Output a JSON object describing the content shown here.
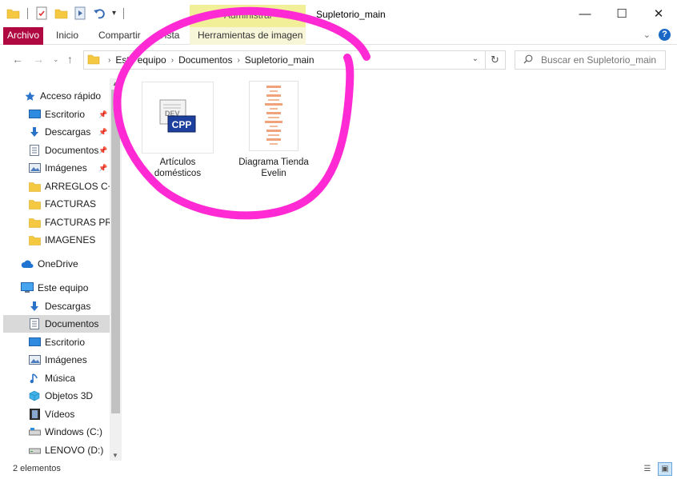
{
  "titlebar": {
    "title": "Supletorio_main",
    "context_group": "Administrar"
  },
  "ribbon": {
    "tabs": [
      "Archivo",
      "Inicio",
      "Compartir",
      "Vista",
      "Herramientas de imagen"
    ]
  },
  "address": {
    "crumbs": [
      "Este equipo",
      "Documentos",
      "Supletorio_main"
    ],
    "search_placeholder": "Buscar en Supletorio_main"
  },
  "sidebar": {
    "quick_access": "Acceso rápido",
    "quick_items": [
      {
        "label": "Escritorio",
        "icon": "desktop-icon",
        "pinned": true
      },
      {
        "label": "Descargas",
        "icon": "download-icon",
        "pinned": true
      },
      {
        "label": "Documentos",
        "icon": "document-icon",
        "pinned": true
      },
      {
        "label": "Imágenes",
        "icon": "pictures-icon",
        "pinned": true
      },
      {
        "label": "ARREGLOS C++",
        "icon": "folder-icon",
        "pinned": false
      },
      {
        "label": "FACTURAS",
        "icon": "folder-icon",
        "pinned": false
      },
      {
        "label": "FACTURAS PRODUCTOS",
        "icon": "folder-icon",
        "pinned": false
      },
      {
        "label": "IMAGENES",
        "icon": "folder-icon",
        "pinned": false
      }
    ],
    "onedrive": "OneDrive",
    "this_pc": "Este equipo",
    "pc_items": [
      {
        "label": "Descargas",
        "icon": "download-icon"
      },
      {
        "label": "Documentos",
        "icon": "document-icon"
      },
      {
        "label": "Escritorio",
        "icon": "desktop-icon"
      },
      {
        "label": "Imágenes",
        "icon": "pictures-icon"
      },
      {
        "label": "Música",
        "icon": "music-icon"
      },
      {
        "label": "Objetos 3D",
        "icon": "3d-objects-icon"
      },
      {
        "label": "Vídeos",
        "icon": "videos-icon"
      },
      {
        "label": "Windows (C:)",
        "icon": "drive-icon"
      },
      {
        "label": "LENOVO (D:)",
        "icon": "drive-icon"
      }
    ],
    "selected": "Documentos"
  },
  "files": [
    {
      "name": "Artículos domésticos",
      "icon": "cpp-file-icon",
      "badge": "CPP"
    },
    {
      "name": "Diagrama Tienda Evelin",
      "icon": "image-thumbnail-icon"
    }
  ],
  "status": {
    "count": "2 elementos"
  },
  "colors": {
    "file_tab": "#b00840",
    "context_tab": "#f1ef97",
    "annotation": "#ff2ad4",
    "selection": "#d9d9d9"
  }
}
